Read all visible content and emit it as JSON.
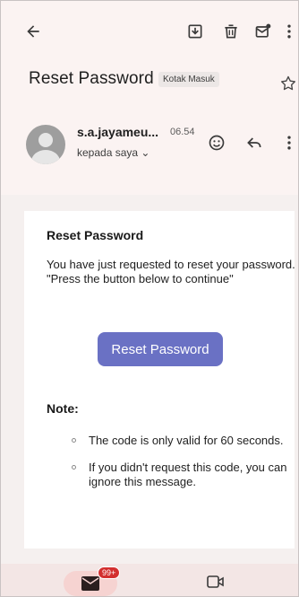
{
  "toolbar": {
    "back_icon": "arrow-left-icon",
    "archive_icon": "archive-icon",
    "delete_icon": "trash-icon",
    "unread_icon": "mark-unread-icon",
    "more_icon": "more-vert-icon"
  },
  "subject": {
    "title": "Reset Password",
    "label": "Kotak Masuk",
    "star_icon": "star-outline-icon"
  },
  "sender": {
    "name": "s.a.jayameu...",
    "time": "06.54",
    "to": "kepada saya ⌄",
    "emoji_icon": "emoji-icon",
    "reply_icon": "reply-icon",
    "more_icon": "more-vert-icon"
  },
  "email": {
    "heading": "Reset Password",
    "body": "You have just requested to reset your password. \"Press the button below to continue\"",
    "button_label": "Reset Password",
    "note_title": "Note:",
    "notes": [
      "The code is only valid for 60 seconds.",
      "If you didn't request this code, you can ignore this message."
    ]
  },
  "bottom_nav": {
    "mail_badge": "99+",
    "mail_icon": "mail-icon",
    "meet_icon": "video-icon"
  },
  "colors": {
    "accent_button": "#6a71c4",
    "badge": "#d32f2f",
    "background": "#fbf3f2"
  }
}
